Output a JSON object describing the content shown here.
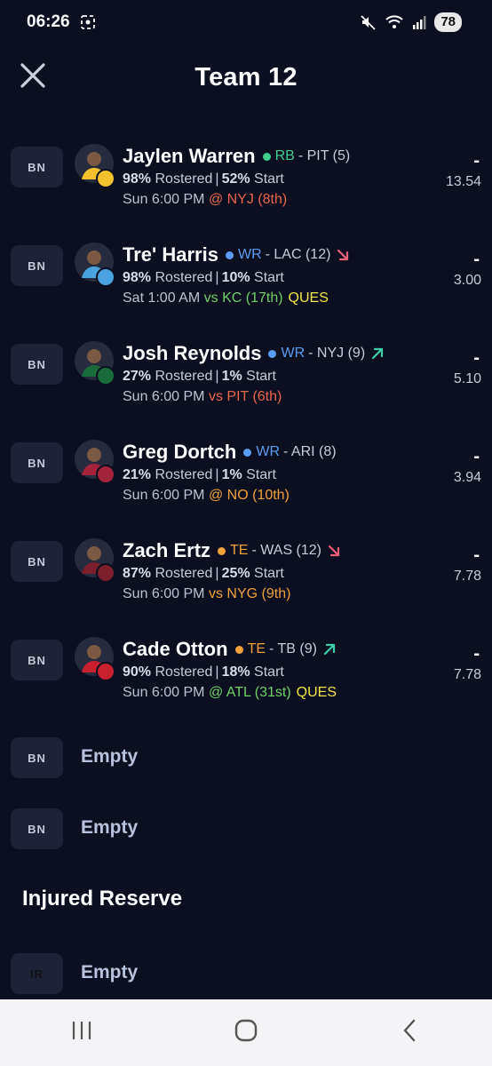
{
  "status": {
    "time": "06:26",
    "battery": "78"
  },
  "header": {
    "title": "Team 12"
  },
  "players": [
    {
      "slot": "BN",
      "name": "Jaylen Warren",
      "position": "RB",
      "pos_color": "#3ecf8e",
      "team": "- PIT (5)",
      "trend": "",
      "rostered": "98%",
      "rostered_label": "Rostered",
      "start": "52%",
      "start_label": "Start",
      "game_time": "Sun 6:00 PM",
      "opponent": "@ NYJ (8th)",
      "opp_color": "#e8664c",
      "status_tag": "",
      "dash": "-",
      "projection": "13.54",
      "logo_color": "#f2c12e"
    },
    {
      "slot": "BN",
      "name": "Tre' Harris",
      "position": "WR",
      "pos_color": "#5b9cf2",
      "team": "- LAC (12)",
      "trend": "down",
      "rostered": "98%",
      "rostered_label": "Rostered",
      "start": "10%",
      "start_label": "Start",
      "game_time": "Sat 1:00 AM",
      "opponent": "vs KC (17th)",
      "opp_color": "#6fd06a",
      "status_tag": "QUES",
      "dash": "-",
      "projection": "3.00",
      "logo_color": "#4aa3df"
    },
    {
      "slot": "BN",
      "name": "Josh Reynolds",
      "position": "WR",
      "pos_color": "#5b9cf2",
      "team": "- NYJ (9)",
      "trend": "up",
      "rostered": "27%",
      "rostered_label": "Rostered",
      "start": "1%",
      "start_label": "Start",
      "game_time": "Sun 6:00 PM",
      "opponent": "vs PIT (6th)",
      "opp_color": "#e8664c",
      "status_tag": "",
      "dash": "-",
      "projection": "5.10",
      "logo_color": "#1a6b3c"
    },
    {
      "slot": "BN",
      "name": "Greg Dortch",
      "position": "WR",
      "pos_color": "#5b9cf2",
      "team": "- ARI (8)",
      "trend": "",
      "rostered": "21%",
      "rostered_label": "Rostered",
      "start": "1%",
      "start_label": "Start",
      "game_time": "Sun 6:00 PM",
      "opponent": "@ NO (10th)",
      "opp_color": "#f0a13a",
      "status_tag": "",
      "dash": "-",
      "projection": "3.94",
      "logo_color": "#a3233c"
    },
    {
      "slot": "BN",
      "name": "Zach Ertz",
      "position": "TE",
      "pos_color": "#f0a13a",
      "team": "- WAS (12)",
      "trend": "down",
      "rostered": "87%",
      "rostered_label": "Rostered",
      "start": "25%",
      "start_label": "Start",
      "game_time": "Sun 6:00 PM",
      "opponent": "vs NYG (9th)",
      "opp_color": "#f0a13a",
      "status_tag": "",
      "dash": "-",
      "projection": "7.78",
      "logo_color": "#7a1f2b"
    },
    {
      "slot": "BN",
      "name": "Cade Otton",
      "position": "TE",
      "pos_color": "#f0a13a",
      "team": "- TB (9)",
      "trend": "up",
      "rostered": "90%",
      "rostered_label": "Rostered",
      "start": "18%",
      "start_label": "Start",
      "game_time": "Sun 6:00 PM",
      "opponent": "@ ATL (31st)",
      "opp_color": "#6fd06a",
      "status_tag": "QUES",
      "dash": "-",
      "projection": "7.78",
      "logo_color": "#c8202f"
    }
  ],
  "empty_slots": [
    {
      "slot": "BN",
      "label": "Empty"
    },
    {
      "slot": "BN",
      "label": "Empty"
    }
  ],
  "injured_reserve": {
    "title": "Injured Reserve",
    "slot": "IR",
    "label": "Empty"
  },
  "colors": {
    "background": "#0b0f1f",
    "badge": "#1d2236",
    "trend_down": "#f0607a",
    "trend_up": "#3ecfa8",
    "ques": "#f2e44a"
  },
  "icons": {
    "close": "close-icon",
    "nav_recent": "recent-apps-icon",
    "nav_home": "home-icon",
    "nav_back": "back-icon"
  }
}
